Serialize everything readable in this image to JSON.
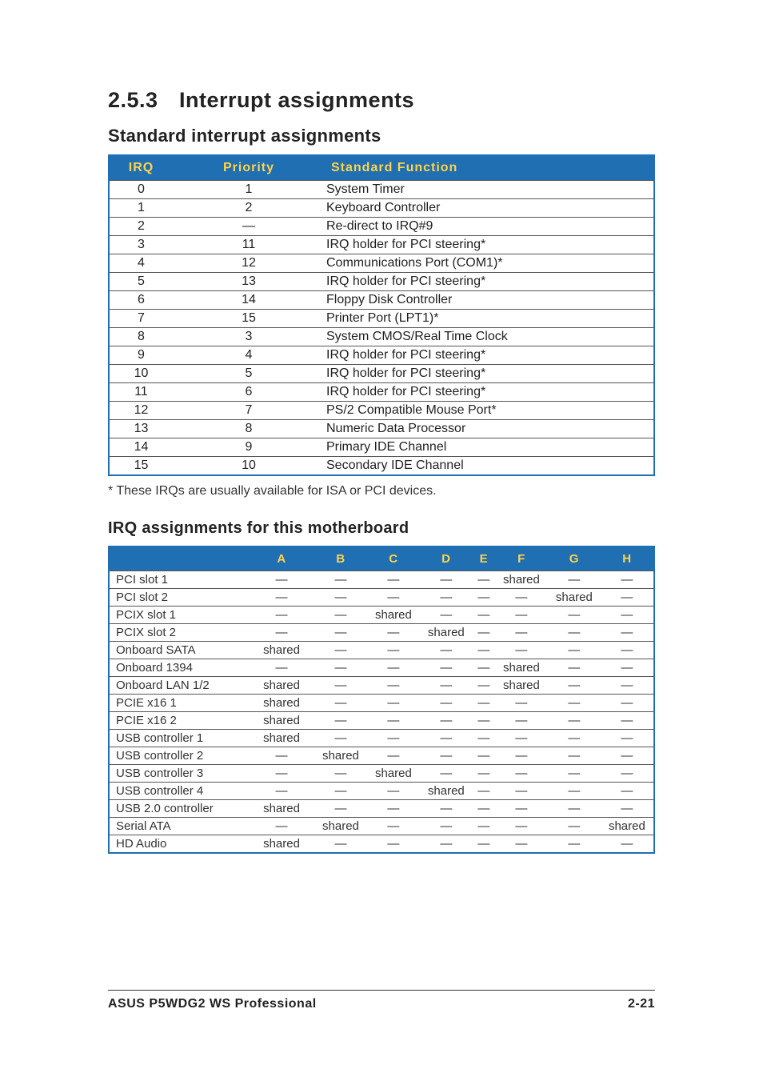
{
  "heading": {
    "number": "2.5.3",
    "title": "Interrupt assignments"
  },
  "section1_title": "Standard interrupt assignments",
  "table1": {
    "headers": [
      "IRQ",
      "Priority",
      "Standard Function"
    ],
    "rows": [
      {
        "irq": "0",
        "priority": "1",
        "func": "System Timer"
      },
      {
        "irq": "1",
        "priority": "2",
        "func": "Keyboard Controller"
      },
      {
        "irq": "2",
        "priority": "—",
        "func": "Re-direct to IRQ#9"
      },
      {
        "irq": "3",
        "priority": "11",
        "func": "IRQ holder for PCI steering*"
      },
      {
        "irq": "4",
        "priority": "12",
        "func": "Communications Port (COM1)*"
      },
      {
        "irq": "5",
        "priority": "13",
        "func": "IRQ holder for PCI steering*"
      },
      {
        "irq": "6",
        "priority": "14",
        "func": "Floppy Disk Controller"
      },
      {
        "irq": "7",
        "priority": "15",
        "func": "Printer Port (LPT1)*"
      },
      {
        "irq": "8",
        "priority": "3",
        "func": "System CMOS/Real Time Clock"
      },
      {
        "irq": "9",
        "priority": "4",
        "func": "IRQ holder for PCI steering*"
      },
      {
        "irq": "10",
        "priority": "5",
        "func": "IRQ holder for PCI steering*"
      },
      {
        "irq": "11",
        "priority": "6",
        "func": "IRQ holder for PCI steering*"
      },
      {
        "irq": "12",
        "priority": "7",
        "func": "PS/2 Compatible Mouse Port*"
      },
      {
        "irq": "13",
        "priority": "8",
        "func": "Numeric Data Processor"
      },
      {
        "irq": "14",
        "priority": "9",
        "func": "Primary IDE Channel"
      },
      {
        "irq": "15",
        "priority": "10",
        "func": "Secondary IDE Channel"
      }
    ]
  },
  "note_text": "* These IRQs are usually available for ISA or PCI devices.",
  "section2_title": "IRQ assignments for this motherboard",
  "table2": {
    "headers": [
      "",
      "A",
      "B",
      "C",
      "D",
      "E",
      "F",
      "G",
      "H"
    ],
    "rows": [
      {
        "name": "PCI slot 1",
        "cells": [
          "—",
          "—",
          "—",
          "—",
          "—",
          "shared",
          "—",
          "—"
        ]
      },
      {
        "name": "PCI slot 2",
        "cells": [
          "—",
          "—",
          "—",
          "—",
          "—",
          "—",
          "shared",
          "—"
        ]
      },
      {
        "name": "PCIX slot 1",
        "cells": [
          "—",
          "—",
          "shared",
          "—",
          "—",
          "—",
          "—",
          "—"
        ]
      },
      {
        "name": "PCIX slot 2",
        "cells": [
          "—",
          "—",
          "—",
          "shared",
          "—",
          "—",
          "—",
          "—"
        ]
      },
      {
        "name": "Onboard SATA",
        "cells": [
          "shared",
          "—",
          "—",
          "—",
          "—",
          "—",
          "—",
          "—"
        ]
      },
      {
        "name": "Onboard 1394",
        "cells": [
          "—",
          "—",
          "—",
          "—",
          "—",
          "shared",
          "—",
          "—"
        ]
      },
      {
        "name": "Onboard LAN 1/2",
        "cells": [
          "shared",
          "—",
          "—",
          "—",
          "—",
          "shared",
          "—",
          "—"
        ]
      },
      {
        "name": "PCIE x16 1",
        "cells": [
          "shared",
          "—",
          "—",
          "—",
          "—",
          "—",
          "—",
          "—"
        ]
      },
      {
        "name": "PCIE x16 2",
        "cells": [
          "shared",
          "—",
          "—",
          "—",
          "—",
          "—",
          "—",
          "—"
        ]
      },
      {
        "name": "USB controller 1",
        "cells": [
          "shared",
          "—",
          "—",
          "—",
          "—",
          "—",
          "—",
          "—"
        ]
      },
      {
        "name": "USB controller 2",
        "cells": [
          "—",
          "shared",
          "—",
          "—",
          "—",
          "—",
          "—",
          "—"
        ]
      },
      {
        "name": "USB controller 3",
        "cells": [
          "—",
          "—",
          "shared",
          "—",
          "—",
          "—",
          "—",
          "—"
        ]
      },
      {
        "name": "USB controller 4",
        "cells": [
          "—",
          "—",
          "—",
          "shared",
          "—",
          "—",
          "—",
          "—"
        ]
      },
      {
        "name": "USB 2.0 controller",
        "cells": [
          "shared",
          "—",
          "—",
          "—",
          "—",
          "—",
          "—",
          "—"
        ]
      },
      {
        "name": "Serial ATA",
        "cells": [
          "—",
          "shared",
          "—",
          "—",
          "—",
          "—",
          "—",
          "shared"
        ]
      },
      {
        "name": "HD Audio",
        "cells": [
          "shared",
          "—",
          "—",
          "—",
          "—",
          "—",
          "—",
          "—"
        ]
      }
    ]
  },
  "footer": {
    "left": "ASUS P5WDG2 WS Professional",
    "right": "2-21"
  }
}
